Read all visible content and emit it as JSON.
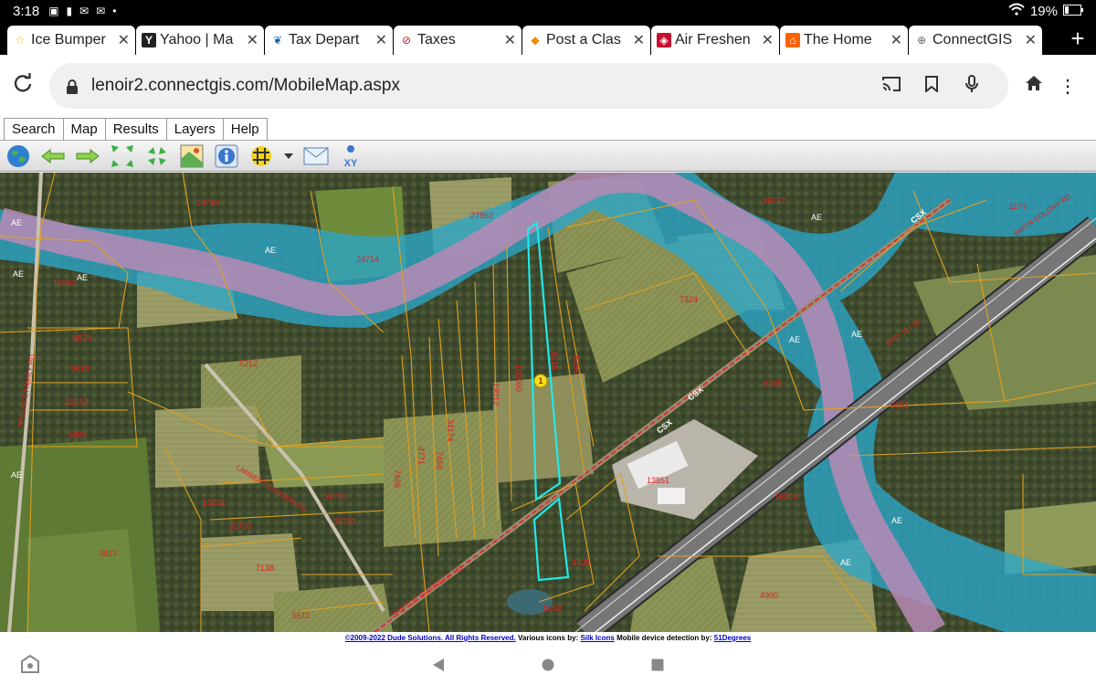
{
  "status_bar": {
    "time": "3:18",
    "battery": "19%"
  },
  "tabs": [
    {
      "label": "Ice Bumper",
      "fav_color": "#f4c11b",
      "fav_glyph": "☆"
    },
    {
      "label": "Yahoo | Ma",
      "fav_color": "#222222",
      "fav_glyph": "Y"
    },
    {
      "label": "Tax Depart",
      "fav_color": "#1a5fa8",
      "fav_glyph": "❦"
    },
    {
      "label": "Taxes",
      "fav_color": "#c02020",
      "fav_glyph": "⊘"
    },
    {
      "label": "Post a Clas",
      "fav_color": "#f08a00",
      "fav_glyph": "◆"
    },
    {
      "label": "Air Freshen",
      "fav_color": "#c8102e",
      "fav_glyph": "◈"
    },
    {
      "label": "The Home",
      "fav_color": "#f96302",
      "fav_glyph": "⌂"
    },
    {
      "label": "ConnectGIS",
      "fav_color": "#666666",
      "fav_glyph": "⊕"
    }
  ],
  "address_bar": {
    "url": "lenoir2.connectgis.com/MobileMap.aspx"
  },
  "app_nav": {
    "tabs": [
      "Search",
      "Map",
      "Results",
      "Layers",
      "Help"
    ]
  },
  "map_labels": {
    "ae": "AE",
    "csx": "CSX",
    "parcels": [
      "24719",
      "27862",
      "35227",
      "1177",
      "10060",
      "24714",
      "7324",
      "8879",
      "5212",
      "8619",
      "22153",
      "9259",
      "6216",
      "8255",
      "19012",
      "100060",
      "8398",
      "9651",
      "5889",
      "4771",
      "7468",
      "31174",
      "7469",
      "13851",
      "15924",
      "35724",
      "35723",
      "10231",
      "36760",
      "3813",
      "7138",
      "4900",
      "5611",
      "8692",
      "4408"
    ],
    "roads": [
      "WALLACE FAMILY RD",
      "SMITH COLONY RD",
      "HWY 11 / 55",
      "LAMBERT DAWSON RD",
      "GRIFTON GRAINGER RD"
    ],
    "marker": "1"
  },
  "footer": {
    "copyright": "©2009-2022 Dude Solutions. All Rights Reserved.",
    "icons_text": "Various icons by:",
    "icons_link": "Silk Icons",
    "detection_text": "Mobile device detection by:",
    "detection_link": "51Degrees"
  },
  "toolbar": {
    "xy_label": "XY"
  },
  "colors": {
    "flood_blue": "#2aa6c9",
    "floodway_purple": "#b78ab5",
    "parcel_line": "#e0a020",
    "selection": "#22e8e8",
    "label_red": "#e02020"
  }
}
